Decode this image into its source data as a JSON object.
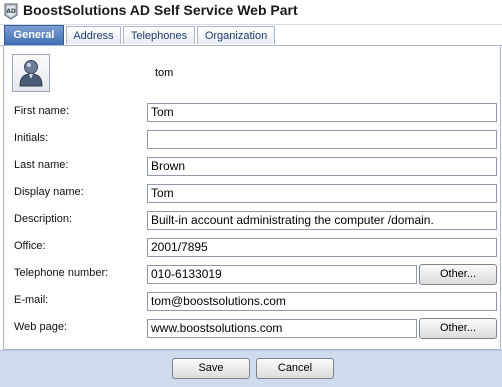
{
  "title": "BoostSolutions AD Self Service Web Part",
  "tabs": [
    "General",
    "Address",
    "Telephones",
    "Organization"
  ],
  "user": {
    "name": "tom"
  },
  "form": {
    "first_name": {
      "label": "First name:",
      "value": "Tom"
    },
    "initials": {
      "label": "Initials:",
      "value": ""
    },
    "last_name": {
      "label": "Last name:",
      "value": "Brown"
    },
    "display_name": {
      "label": "Display name:",
      "value": "Tom"
    },
    "description": {
      "label": "Description:",
      "value": "Built-in account administrating the computer /domain."
    },
    "office": {
      "label": "Office:",
      "value": "2001/7895"
    },
    "telephone": {
      "label": "Telephone number:",
      "value": "010-6133019",
      "other_label": "Other..."
    },
    "email": {
      "label": "E-mail:",
      "value": "tom@boostsolutions.com"
    },
    "web_page": {
      "label": "Web page:",
      "value": "www.boostsolutions.com",
      "other_label": "Other..."
    }
  },
  "footer": {
    "save_label": "Save",
    "cancel_label": "Cancel"
  },
  "colors": {
    "active_tab": "#3e6db2",
    "tab_text": "#1f3c6b",
    "footer_bg": "#cfdcee"
  }
}
